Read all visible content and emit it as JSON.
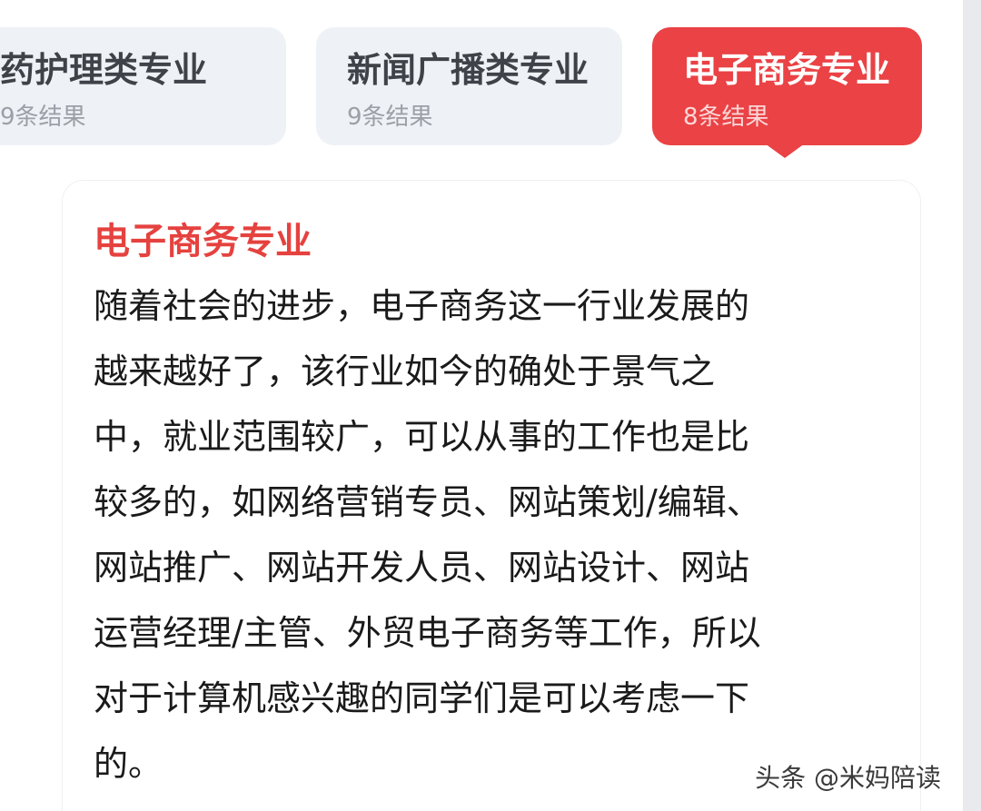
{
  "tabs": [
    {
      "label": "医药护理类专业",
      "count": "9条结果",
      "active": false
    },
    {
      "label": "新闻广播类专业",
      "count": "9条结果",
      "active": false
    },
    {
      "label": "电子商务专业",
      "count": "8条结果",
      "active": true
    }
  ],
  "detail": {
    "title": "电子商务专业",
    "lines": [
      "随着社会的进步，电子商务这一行业发展的",
      "越来越好了，该行业如今的确处于景气之",
      "中，就业范围较广，可以从事的工作也是比",
      "较多的，如网络营销专员、网站策划/编辑、",
      "网站推广、网站开发人员、网站设计、网站",
      "运营经理/主管、外贸电子商务等工作，所以",
      "对于计算机感兴趣的同学们是可以考虑一下",
      "的。"
    ]
  },
  "watermark": "头条 @米妈陪读",
  "colors": {
    "accent": "#ea4245",
    "tab_bg": "#eef1f5",
    "title_red": "#e5423f"
  }
}
